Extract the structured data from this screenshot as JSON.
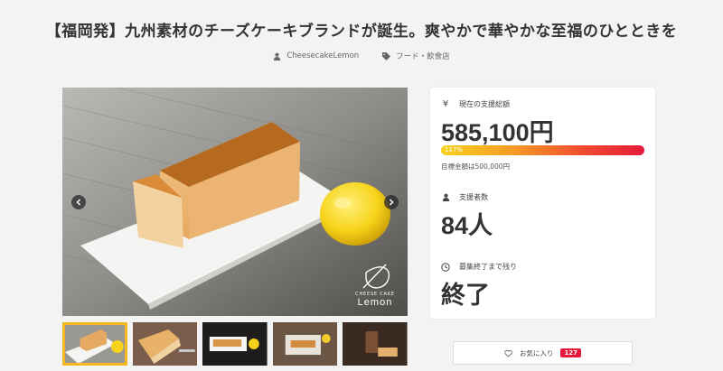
{
  "project": {
    "title": "【福岡発】九州素材のチーズケーキブランドが誕生。爽やかで華やかな至福のひとときを",
    "owner": "CheesecakeLemon",
    "category": "フード・飲食店"
  },
  "gallery": {
    "brand_line1": "CHEESE CAKE",
    "brand_line2": "Lemon",
    "thumbnail_count": 5,
    "active_thumbnail": 0
  },
  "stats": {
    "raised_label": "現在の支援総額",
    "raised_value": "585,100円",
    "progress_percent": 117,
    "progress_text": "117%",
    "goal_text": "目標金額は500,000円",
    "supporters_label": "支援者数",
    "supporters_value": "84人",
    "remaining_label": "募集終了まで残り",
    "remaining_value": "終了"
  },
  "favorite": {
    "label": "お気に入り",
    "count": "127"
  },
  "colors": {
    "progress_start": "#f8d21f",
    "progress_end": "#e51b3a",
    "badge": "#e5173a",
    "thumb_active": "#f5b81e"
  },
  "icons": [
    "user-icon",
    "tag-icon",
    "yen-icon",
    "supporters-icon",
    "clock-icon",
    "heart-icon",
    "chevron-left-icon",
    "chevron-right-icon"
  ]
}
